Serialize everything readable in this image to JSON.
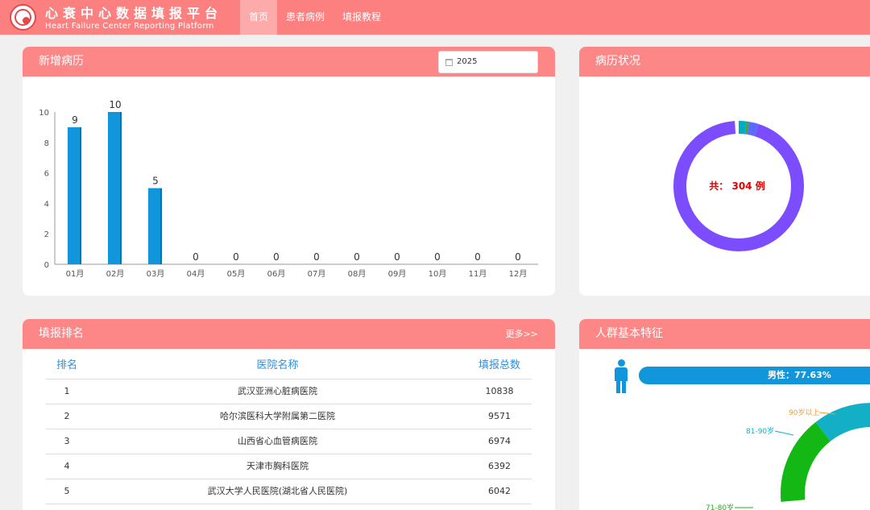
{
  "header": {
    "title_cn": "心衰中心数据填报平台",
    "title_en": "Heart Failure Center Reporting Platform",
    "nav": [
      {
        "label": "首页",
        "active": true
      },
      {
        "label": "患者病例",
        "active": false
      },
      {
        "label": "填报教程",
        "active": false
      }
    ]
  },
  "new_cases": {
    "title": "新增病历",
    "year_value": "2025"
  },
  "chart_data": [
    {
      "type": "bar",
      "categories": [
        "01月",
        "02月",
        "03月",
        "04月",
        "05月",
        "06月",
        "07月",
        "08月",
        "09月",
        "10月",
        "11月",
        "12月"
      ],
      "values": [
        9,
        10,
        5,
        0,
        0,
        0,
        0,
        0,
        0,
        0,
        0,
        0
      ],
      "ylim": [
        0,
        10
      ],
      "yticks": [
        0,
        2,
        4,
        6,
        8,
        10
      ],
      "color": "#1296db"
    },
    {
      "type": "pie",
      "segments": [
        {
          "value": 286,
          "color": "#7c4dff"
        },
        {
          "value": 3,
          "color": "#e040fb"
        },
        {
          "value": 6,
          "color": "#00acc1"
        },
        {
          "value": 2,
          "color": "#43a047"
        },
        {
          "value": 7,
          "color": "#5c6bff"
        }
      ]
    },
    {
      "type": "pie",
      "labels": [
        "90岁以上",
        "81-90岁",
        "71-80岁"
      ],
      "segments": [
        {
          "label": "90岁以上",
          "color": "#f39c2b"
        },
        {
          "label": "81-90岁",
          "color": "#13afc7"
        },
        {
          "label": "71-80岁",
          "color": "#14b814"
        }
      ]
    }
  ],
  "status": {
    "title": "病历状况",
    "total_label": "共： 304 例"
  },
  "ranking": {
    "title": "填报排名",
    "more_label": "更多>>",
    "headers": {
      "rank": "排名",
      "name": "医院名称",
      "total": "填报总数"
    },
    "rows": [
      {
        "rank": "1",
        "name": "武汉亚洲心脏病医院",
        "total": "10838"
      },
      {
        "rank": "2",
        "name": "哈尔滨医科大学附属第二医院",
        "total": "9571"
      },
      {
        "rank": "3",
        "name": "山西省心血管病医院",
        "total": "6974"
      },
      {
        "rank": "4",
        "name": "天津市胸科医院",
        "total": "6392"
      },
      {
        "rank": "5",
        "name": "武汉大学人民医院(湖北省人民医院)",
        "total": "6042"
      }
    ]
  },
  "people": {
    "title": "人群基本特征",
    "male_label": "男性：77.63%",
    "male_percent": 77.63
  },
  "colors": {
    "header_bg": "#fd8080",
    "card_head_bg": "#fd8787",
    "bar_blue": "#1296db",
    "table_header_blue": "#2e8fd6",
    "total_text_red": "#e00000"
  }
}
